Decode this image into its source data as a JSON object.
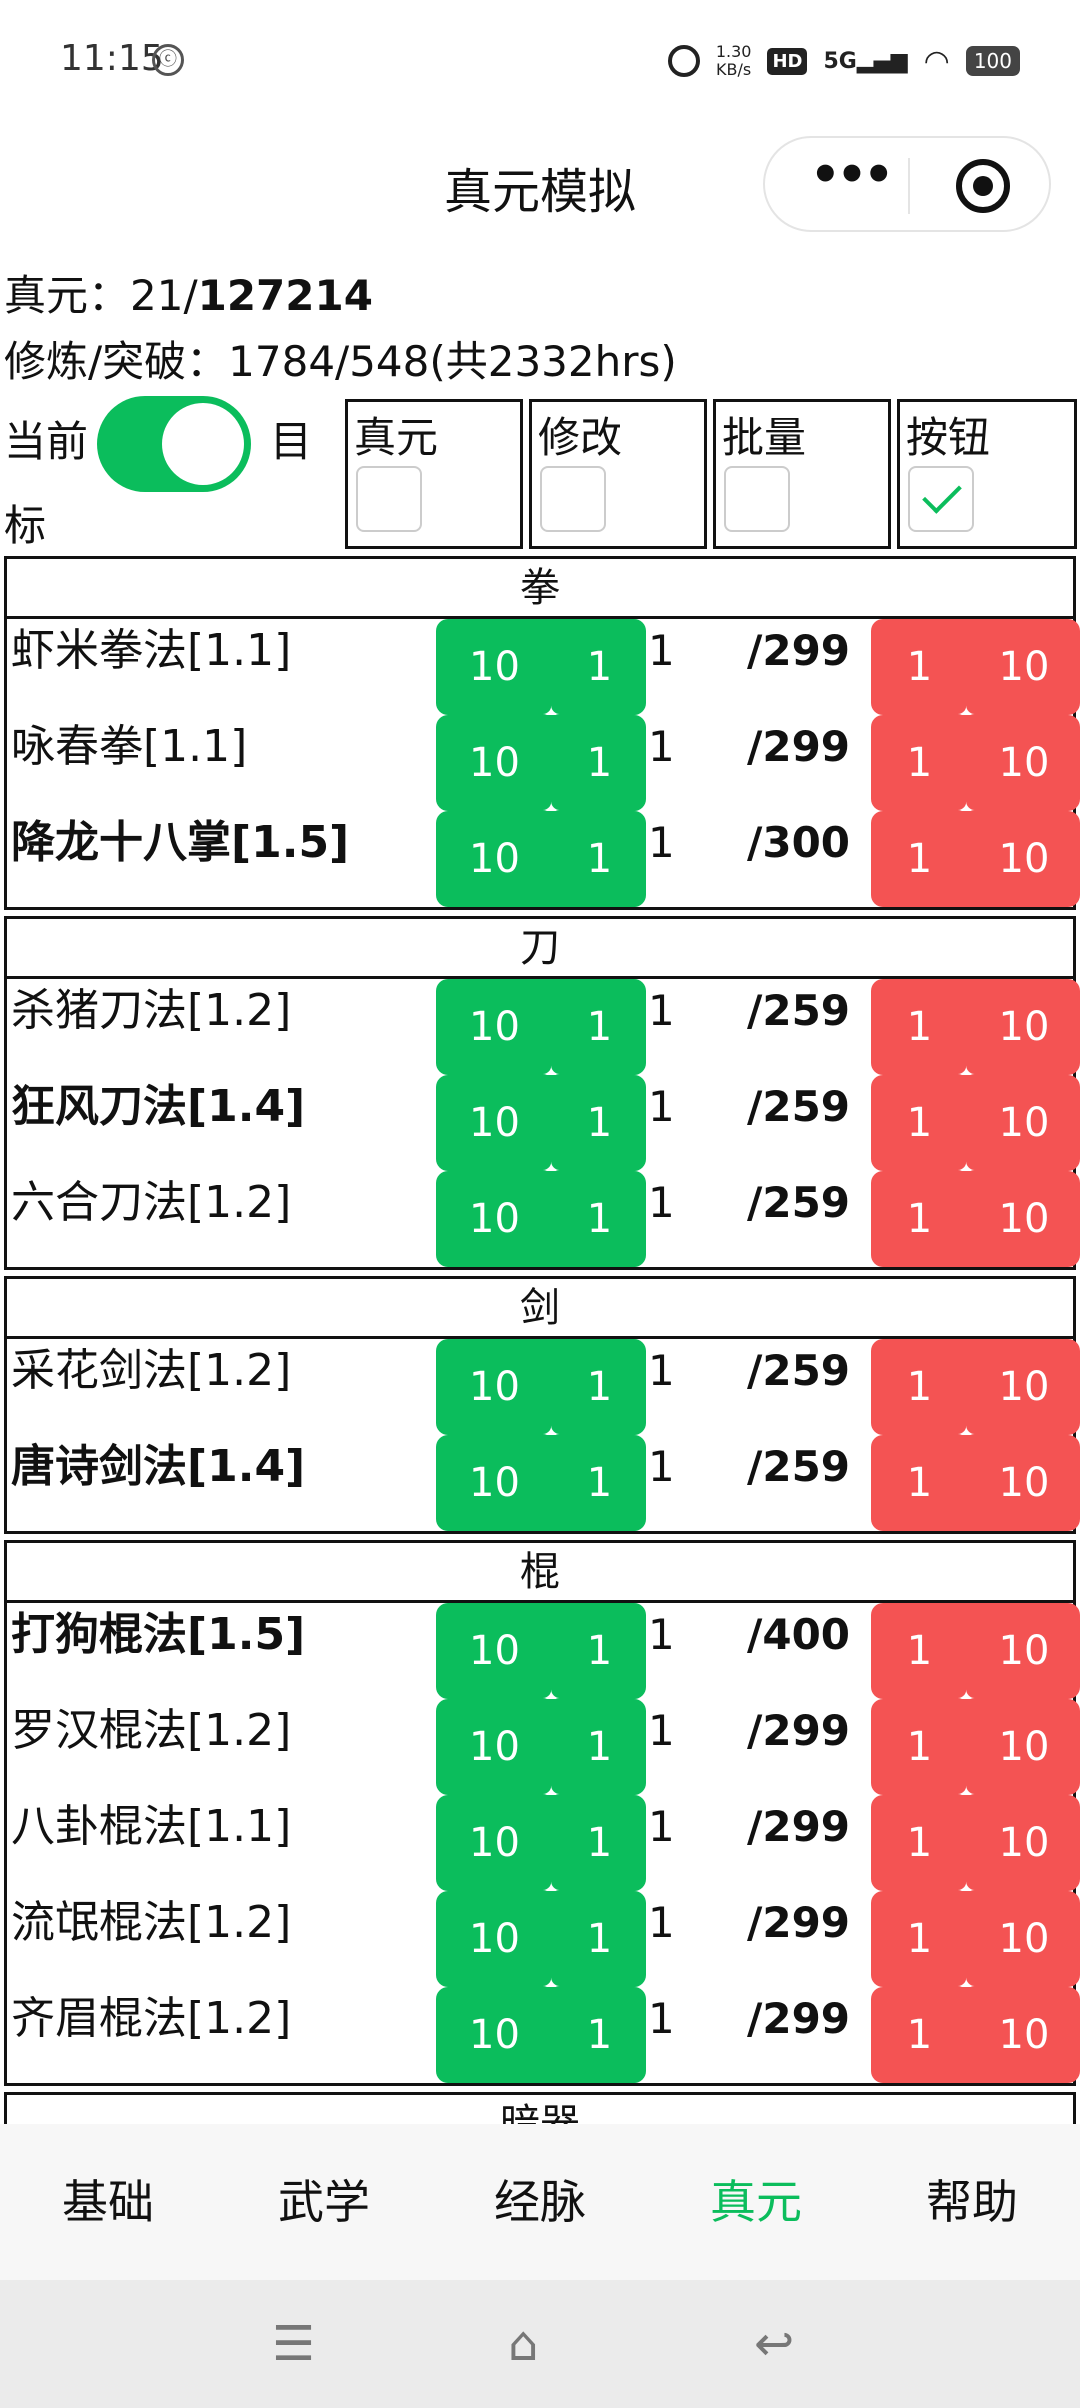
{
  "status": {
    "time": "11:15",
    "speed_value": "1.30",
    "speed_unit": "KB/s",
    "hd": "HD",
    "network": "5G",
    "battery": "100"
  },
  "navbar": {
    "title": "真元模拟"
  },
  "info": {
    "zhenyuan_label": "真元：21/",
    "zhenyuan_total": "127214",
    "practice_text": "修炼/突破：1784/548(共2332hrs)"
  },
  "mode": {
    "current_label": "当前",
    "target_label_part1": "目",
    "target_label_part2": "标",
    "toggle_on": true
  },
  "options": [
    {
      "label": "真元",
      "checked": false
    },
    {
      "label": "修改",
      "checked": false
    },
    {
      "label": "批量",
      "checked": false
    },
    {
      "label": "按钮",
      "checked": true
    }
  ],
  "buttons": {
    "green_big": "10",
    "green_small": "1",
    "red_small": "1",
    "red_big": "10"
  },
  "sections": [
    {
      "title": "拳",
      "items": [
        {
          "name": "虾米拳法[1.1]",
          "bold": false,
          "level": "1",
          "max": "/299"
        },
        {
          "name": "咏春拳[1.1]",
          "bold": false,
          "level": "1",
          "max": "/299"
        },
        {
          "name": "降龙十八掌[1.5]",
          "bold": true,
          "level": "1",
          "max": "/300"
        }
      ]
    },
    {
      "title": "刀",
      "items": [
        {
          "name": "杀猪刀法[1.2]",
          "bold": false,
          "level": "1",
          "max": "/259"
        },
        {
          "name": "狂风刀法[1.4]",
          "bold": true,
          "level": "1",
          "max": "/259"
        },
        {
          "name": "六合刀法[1.2]",
          "bold": false,
          "level": "1",
          "max": "/259"
        }
      ]
    },
    {
      "title": "剑",
      "items": [
        {
          "name": "采花剑法[1.2]",
          "bold": false,
          "level": "1",
          "max": "/259"
        },
        {
          "name": "唐诗剑法[1.4]",
          "bold": true,
          "level": "1",
          "max": "/259"
        }
      ]
    },
    {
      "title": "棍",
      "items": [
        {
          "name": "打狗棍法[1.5]",
          "bold": true,
          "level": "1",
          "max": "/400"
        },
        {
          "name": "罗汉棍法[1.2]",
          "bold": false,
          "level": "1",
          "max": "/299"
        },
        {
          "name": "八卦棍法[1.1]",
          "bold": false,
          "level": "1",
          "max": "/299"
        },
        {
          "name": "流氓棍法[1.2]",
          "bold": false,
          "level": "1",
          "max": "/299"
        },
        {
          "name": "齐眉棍法[1.2]",
          "bold": false,
          "level": "1",
          "max": "/299"
        }
      ]
    },
    {
      "title": "暗器",
      "items": []
    }
  ],
  "tabs": [
    {
      "label": "基础",
      "active": false
    },
    {
      "label": "武学",
      "active": false
    },
    {
      "label": "经脉",
      "active": false
    },
    {
      "label": "真元",
      "active": true
    },
    {
      "label": "帮助",
      "active": false
    }
  ],
  "colors": {
    "green": "#0bbd5c",
    "red": "#f45353"
  }
}
